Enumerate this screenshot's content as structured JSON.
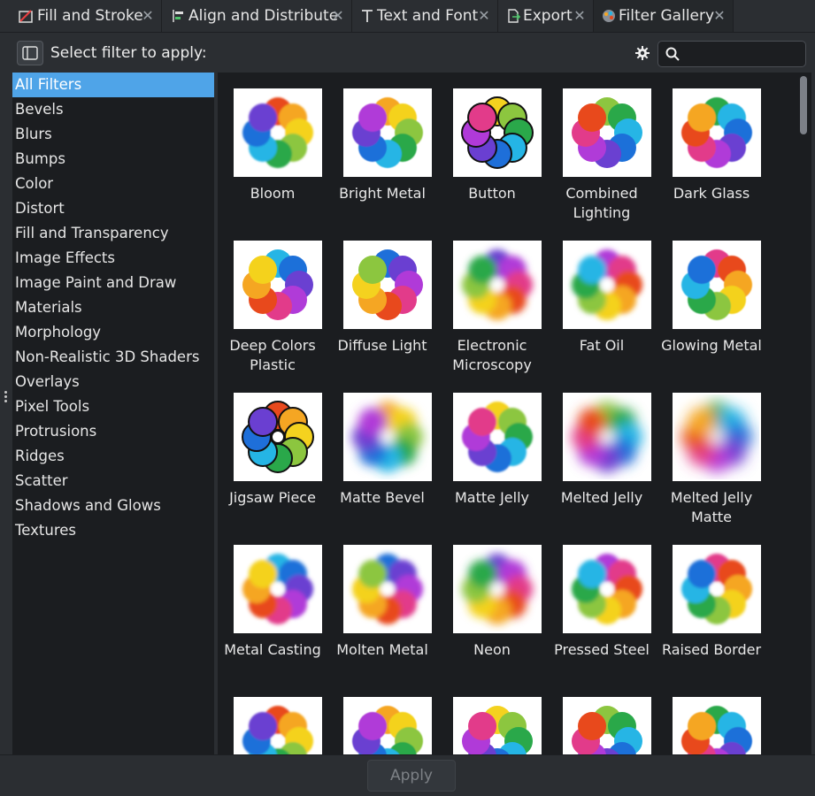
{
  "tabs": [
    {
      "label": "Fill and Stroke",
      "icon": "fill-stroke-icon"
    },
    {
      "label": "Align and Distribute",
      "icon": "align-icon"
    },
    {
      "label": "Text and Font",
      "icon": "text-icon"
    },
    {
      "label": "Export",
      "icon": "export-icon"
    },
    {
      "label": "Filter Gallery",
      "icon": "filter-gallery-icon"
    }
  ],
  "header": {
    "label": "Select filter to apply:",
    "search_value": "",
    "search_placeholder": ""
  },
  "categories": [
    "All Filters",
    "Bevels",
    "Blurs",
    "Bumps",
    "Color",
    "Distort",
    "Fill and Transparency",
    "Image Effects",
    "Image Paint and Draw",
    "Materials",
    "Morphology",
    "Non-Realistic 3D Shaders",
    "Overlays",
    "Pixel Tools",
    "Protrusions",
    "Ridges",
    "Scatter",
    "Shadows and Glows",
    "Textures"
  ],
  "selected_category": "All Filters",
  "filters": [
    [
      "Bloom",
      "Bright Metal",
      "Button",
      "Combined Lighting",
      "Dark Glass"
    ],
    [
      "Deep Colors Plastic",
      "Diffuse Light",
      "Electronic Microscopy",
      "Fat Oil",
      "Glowing Metal"
    ],
    [
      "Jigsaw Piece",
      "Matte Bevel",
      "Matte Jelly",
      "Melted Jelly",
      "Melted Jelly Matte"
    ],
    [
      "Metal Casting",
      "Molten Metal",
      "Neon",
      "Pressed Steel",
      "Raised Border"
    ],
    [
      "",
      "",
      "",
      "",
      ""
    ]
  ],
  "apply_label": "Apply",
  "colors": {
    "accent": "#4fa4e8",
    "panel_bg": "#1b1d20",
    "window_bg": "#2b2e32",
    "petals": [
      "#e8491d",
      "#f5a623",
      "#f4d21f",
      "#8cc63f",
      "#2aa84a",
      "#25b5e5",
      "#1e6fd9",
      "#6a3fd1",
      "#b03ad8",
      "#e23b8a"
    ]
  }
}
